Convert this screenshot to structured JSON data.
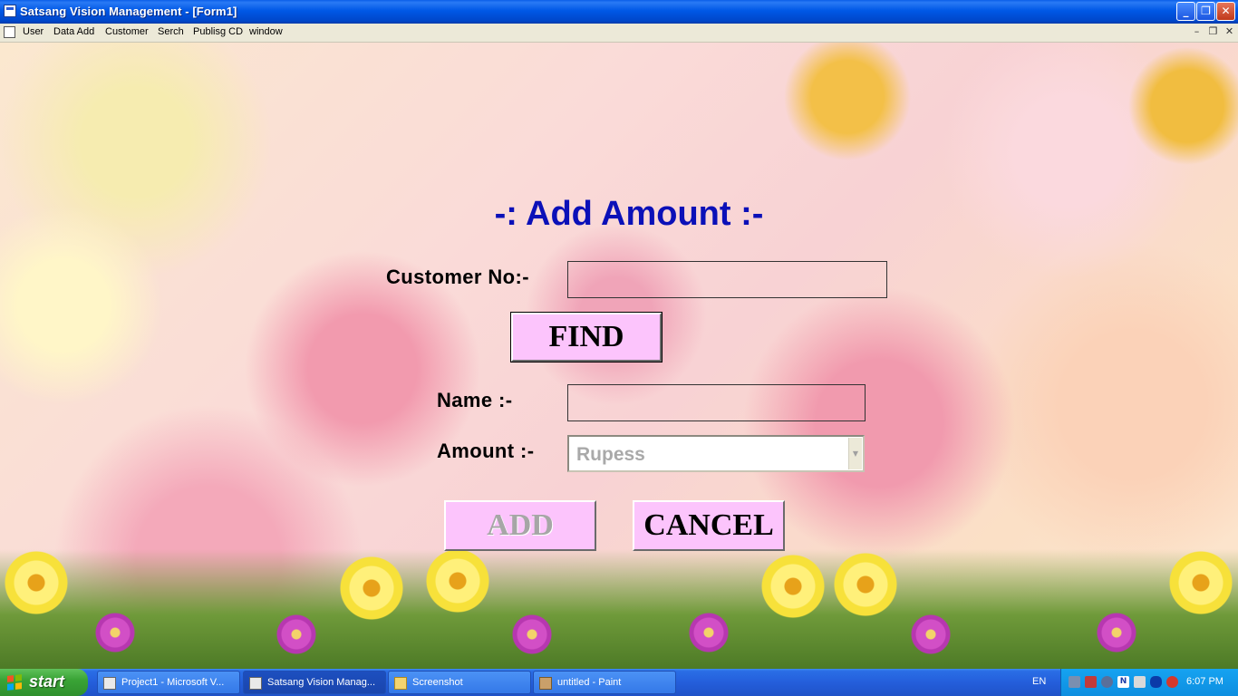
{
  "window": {
    "title": "Satsang Vision Management - [Form1]",
    "min_symbol": "_",
    "restore_symbol": "❐",
    "close_symbol": "✕"
  },
  "menu": {
    "items": [
      "User",
      "Data Add",
      "Customer",
      "Serch",
      "Publisg CD",
      "window"
    ],
    "mdi_min": "–",
    "mdi_restore": "❐",
    "mdi_close": "✕"
  },
  "form": {
    "heading": "-: Add Amount :-",
    "customer_label": "Customer No:-",
    "customer_value": "",
    "find_label": "FIND",
    "name_label": "Name :-",
    "name_value": "",
    "amount_label": "Amount :-",
    "amount_selected": "Rupess",
    "amount_arrow": "▼",
    "add_label": "ADD",
    "cancel_label": "CANCEL"
  },
  "taskbar": {
    "start_label": "start",
    "tasks": [
      {
        "label": "Project1 - Microsoft V...",
        "icon": "vb-icon"
      },
      {
        "label": "Satsang Vision Manag...",
        "icon": "app-icon"
      },
      {
        "label": "Screenshot",
        "icon": "folder-icon"
      },
      {
        "label": "untitled - Paint",
        "icon": "paint-icon"
      }
    ],
    "language": "EN",
    "tray_icons": [
      "network-icon",
      "security-icon",
      "sync-icon",
      "norton-icon",
      "volume-icon",
      "bluetooth-icon",
      "alert-icon"
    ],
    "clock": "6:07 PM"
  },
  "colors": {
    "heading": "#0b10b8",
    "button_fill": "#fcc4fc",
    "titlebar": "#0058e6",
    "start_green": "#3aa436"
  }
}
